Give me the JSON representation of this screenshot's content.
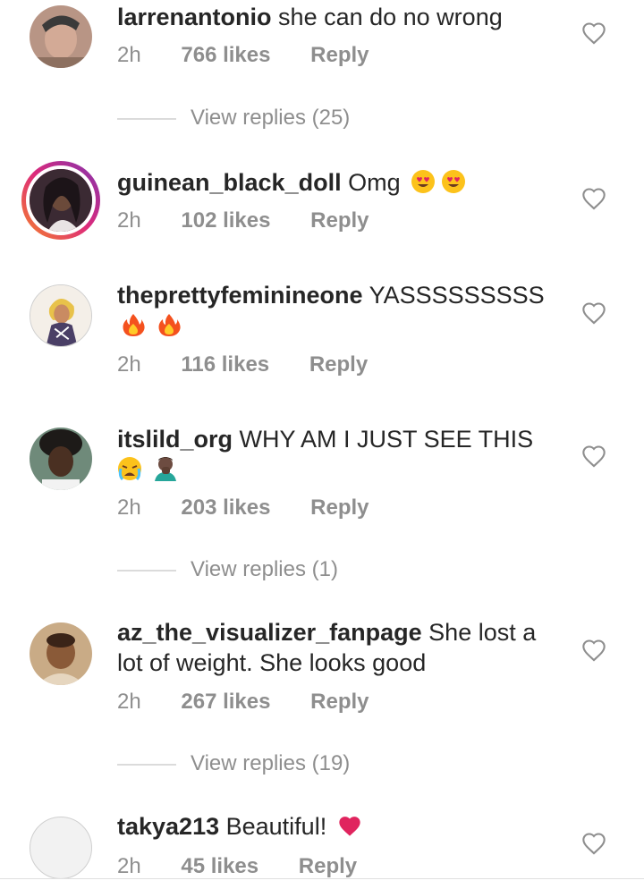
{
  "comments": [
    {
      "username": "larrenantonio",
      "text": "she can do no wrong",
      "time": "2h",
      "likes": "766 likes",
      "reply": "Reply",
      "view_replies": "View replies (25)"
    },
    {
      "username": "guinean_black_doll",
      "text": "Omg",
      "time": "2h",
      "likes": "102 likes",
      "reply": "Reply",
      "emojis": [
        "heart-eyes-emoji",
        "heart-eyes-emoji"
      ]
    },
    {
      "username": "theprettyfeminineone",
      "text": "YASSSSSSSSS",
      "time": "2h",
      "likes": "116 likes",
      "reply": "Reply",
      "emojis": [
        "fire-emoji",
        "fire-emoji"
      ]
    },
    {
      "username": "itslild_org",
      "text": "WHY AM I JUST SEE THIS",
      "time": "2h",
      "likes": "203 likes",
      "reply": "Reply",
      "view_replies": "View replies (1)",
      "emojis": [
        "crying-emoji",
        "facepalm-emoji"
      ]
    },
    {
      "username": "az_the_visualizer_fanpage",
      "text": "She lost a lot of weight. She looks good",
      "time": "2h",
      "likes": "267 likes",
      "reply": "Reply",
      "view_replies": "View replies (19)"
    },
    {
      "username": "takya213",
      "text": "Beautiful!",
      "time": "2h",
      "likes": "45 likes",
      "reply": "Reply",
      "emojis": [
        "red-heart-emoji"
      ]
    }
  ],
  "colors": {
    "text": "#262626",
    "meta": "#8e8e8e",
    "divider": "#dbdbdb",
    "heart_emoji": "#e0245e",
    "story_ring_start": "#f58529",
    "story_ring_end": "#8134af"
  }
}
